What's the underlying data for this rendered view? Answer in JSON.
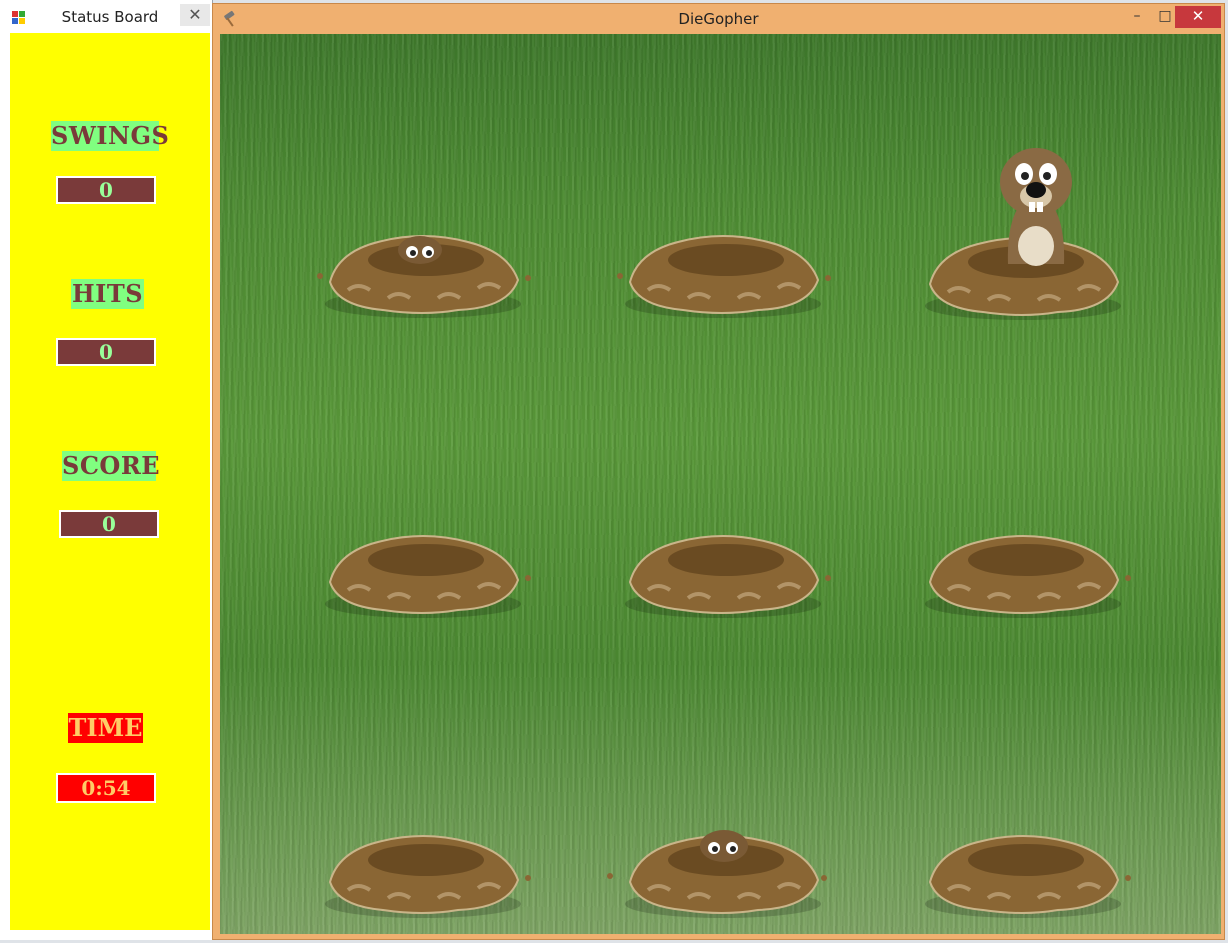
{
  "status_board": {
    "title": "Status Board",
    "close_glyph": "✕",
    "panel_color": "#ffff00",
    "swings": {
      "label": "SWINGS",
      "value": "0"
    },
    "hits": {
      "label": "HITS",
      "value": "0"
    },
    "score": {
      "label": "SCORE",
      "value": "0"
    },
    "time": {
      "label": "TIME",
      "value": "0:54"
    }
  },
  "game_window": {
    "title": "DieGopher",
    "minimize_glyph": "–",
    "maximize_glyph": "□",
    "close_glyph": "✕",
    "frame_color": "#f0b070",
    "holes": [
      {
        "row": 1,
        "col": 1,
        "state": "peeking"
      },
      {
        "row": 1,
        "col": 2,
        "state": "empty"
      },
      {
        "row": 1,
        "col": 3,
        "state": "gopher-up"
      },
      {
        "row": 2,
        "col": 1,
        "state": "empty"
      },
      {
        "row": 2,
        "col": 2,
        "state": "empty"
      },
      {
        "row": 2,
        "col": 3,
        "state": "empty"
      },
      {
        "row": 3,
        "col": 1,
        "state": "empty"
      },
      {
        "row": 3,
        "col": 2,
        "state": "peeking"
      },
      {
        "row": 3,
        "col": 3,
        "state": "empty"
      }
    ]
  }
}
